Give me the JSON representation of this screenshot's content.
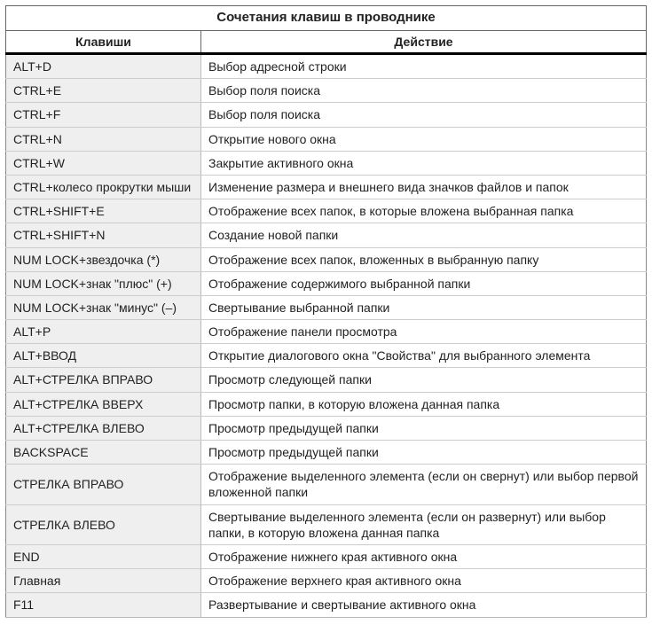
{
  "title": "Сочетания клавиш в проводнике",
  "headers": {
    "keys": "Клавиши",
    "action": "Действие"
  },
  "rows": [
    {
      "keys": "ALT+D",
      "action": "Выбор адресной строки"
    },
    {
      "keys": "CTRL+E",
      "action": "Выбор поля поиска"
    },
    {
      "keys": "CTRL+F",
      "action": "Выбор поля поиска"
    },
    {
      "keys": "CTRL+N",
      "action": "Открытие нового окна"
    },
    {
      "keys": "CTRL+W",
      "action": "Закрытие активного окна"
    },
    {
      "keys": "CTRL+колесо прокрутки мыши",
      "action": "Изменение размера и внешнего вида значков файлов и папок"
    },
    {
      "keys": "CTRL+SHIFT+E",
      "action": "Отображение всех папок, в которые вложена выбранная папка"
    },
    {
      "keys": "CTRL+SHIFT+N",
      "action": "Создание новой папки"
    },
    {
      "keys": "NUM LOCK+звездочка (*)",
      "action": "Отображение всех папок, вложенных в выбранную папку"
    },
    {
      "keys": "NUM LOCK+знак \"плюс\" (+)",
      "action": "Отображение содержимого выбранной папки"
    },
    {
      "keys": "NUM LOCK+знак \"минус\" (–)",
      "action": "Свертывание выбранной папки"
    },
    {
      "keys": "ALT+P",
      "action": "Отображение панели просмотра"
    },
    {
      "keys": "ALT+ВВОД",
      "action": "Открытие диалогового окна \"Свойства\" для выбранного элемента"
    },
    {
      "keys": "ALT+СТРЕЛКА ВПРАВО",
      "action": "Просмотр следующей папки"
    },
    {
      "keys": "ALT+СТРЕЛКА ВВЕРХ",
      "action": "Просмотр папки, в которую вложена данная папка"
    },
    {
      "keys": "ALT+СТРЕЛКА ВЛЕВО",
      "action": "Просмотр предыдущей папки"
    },
    {
      "keys": "BACKSPACE",
      "action": "Просмотр предыдущей папки"
    },
    {
      "keys": "СТРЕЛКА ВПРАВО",
      "action": "Отображение выделенного элемента (если он свернут) или выбор первой вложенной папки"
    },
    {
      "keys": "СТРЕЛКА ВЛЕВО",
      "action": "Свертывание выделенного элемента (если он развернут) или выбор папки, в которую вложена данная папка"
    },
    {
      "keys": "END",
      "action": "Отображение нижнего края активного окна"
    },
    {
      "keys": "Главная",
      "action": "Отображение верхнего края активного окна"
    },
    {
      "keys": "F11",
      "action": "Развертывание и свертывание активного окна"
    }
  ]
}
